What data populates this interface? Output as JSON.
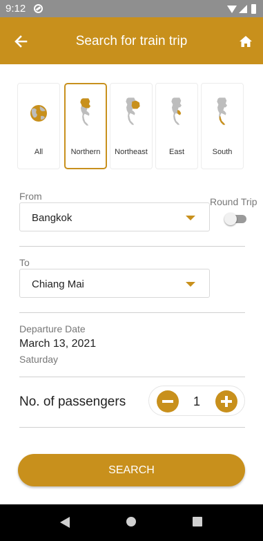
{
  "status_bar": {
    "time": "9:12"
  },
  "header": {
    "title": "Search for train trip"
  },
  "regions": [
    {
      "label": "All"
    },
    {
      "label": "Northern",
      "selected": true
    },
    {
      "label": "Northeast"
    },
    {
      "label": "East"
    },
    {
      "label": "South"
    }
  ],
  "from": {
    "label": "From",
    "value": "Bangkok"
  },
  "round_trip": {
    "label": "Round Trip",
    "enabled": false
  },
  "to": {
    "label": "To",
    "value": "Chiang Mai"
  },
  "departure": {
    "label": "Departure Date",
    "date": "March 13, 2021",
    "day": "Saturday"
  },
  "passengers": {
    "label": "No. of passengers",
    "count": "1"
  },
  "search_button": {
    "label": "SEARCH"
  },
  "colors": {
    "accent": "#c8901c",
    "status_bar": "#8f8f8f",
    "map_gray": "#bdbdbd"
  },
  "icons": {
    "back": "arrow-left-icon",
    "home": "home-icon",
    "minus": "minus-icon",
    "plus": "plus-icon"
  }
}
